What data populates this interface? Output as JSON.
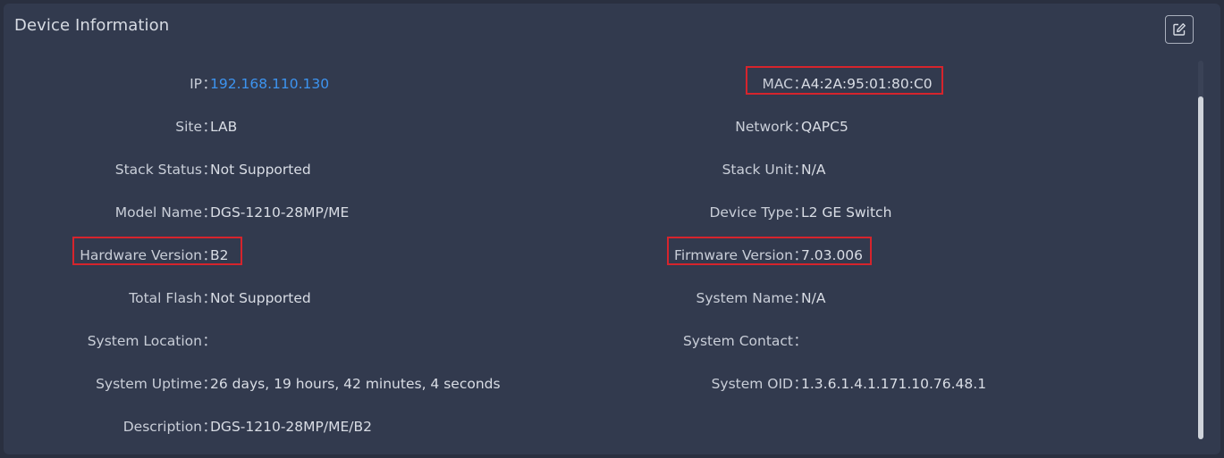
{
  "panel": {
    "title": "Device Information"
  },
  "left": [
    {
      "label": "IP",
      "value": "192.168.110.130",
      "link": true
    },
    {
      "label": "Site",
      "value": "LAB"
    },
    {
      "label": "Stack Status",
      "value": "Not Supported"
    },
    {
      "label": "Model Name",
      "value": "DGS-1210-28MP/ME"
    },
    {
      "label": "Hardware Version",
      "value": "B2"
    },
    {
      "label": "Total Flash",
      "value": "Not Supported"
    },
    {
      "label": "System Location",
      "value": ""
    },
    {
      "label": "System Uptime",
      "value": "26 days, 19 hours, 42 minutes, 4 seconds"
    },
    {
      "label": "Description",
      "value": "DGS-1210-28MP/ME/B2"
    }
  ],
  "right": [
    {
      "label": "MAC",
      "value": "A4:2A:95:01:80:C0"
    },
    {
      "label": "Network",
      "value": "QAPC5"
    },
    {
      "label": "Stack Unit",
      "value": "N/A"
    },
    {
      "label": "Device Type",
      "value": "L2 GE Switch"
    },
    {
      "label": "Firmware Version",
      "value": "7.03.006"
    },
    {
      "label": "System Name",
      "value": "N/A"
    },
    {
      "label": "System Contact",
      "value": ""
    },
    {
      "label": "System OID",
      "value": "1.3.6.1.4.1.171.10.76.48.1"
    }
  ],
  "separator": "：",
  "icons": {
    "edit": "edit-icon"
  },
  "colors": {
    "background": "#2a3040",
    "panel": "#323a4e",
    "link": "#3d94f0",
    "highlight": "#d6242c"
  }
}
